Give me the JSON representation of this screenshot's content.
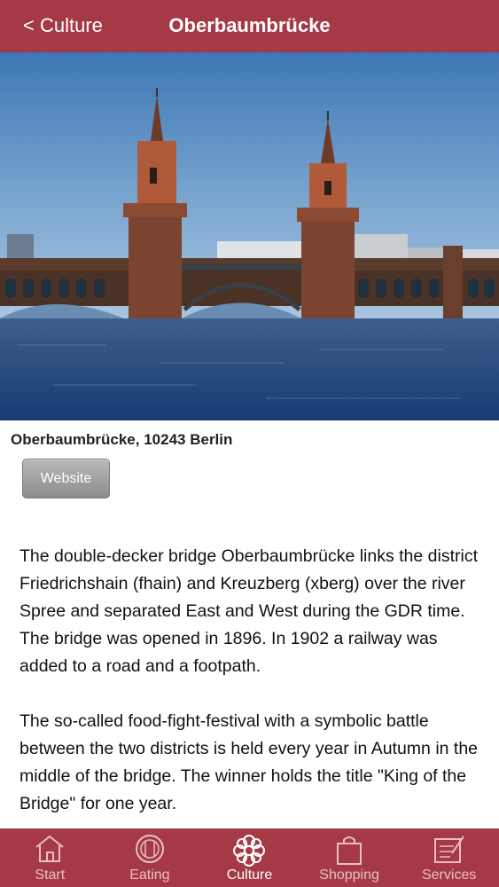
{
  "navbar": {
    "back_label": "< Culture",
    "title": "Oberbaumbrücke"
  },
  "hero": {
    "alt": "Oberbaumbrücke bridge over the river Spree"
  },
  "address": "Oberbaumbrücke, 10243 Berlin",
  "website_button": "Website",
  "paragraphs": [
    "The double-decker bridge Oberbaumbrücke links the district Friedrichshain (fhain) and Kreuzberg (xberg) over the river Spree and separated East and West during the GDR time. The bridge was opened in 1896. In 1902 a railway was added to a road and a footpath.",
    "The so-called food-fight-festival with a symbolic battle between the two districts is held every year in Autumn in the middle of the bridge. The winner holds the title \"King of the Bridge\" for one year."
  ],
  "tabs": [
    {
      "label": "Start",
      "icon": "home-icon",
      "active": false
    },
    {
      "label": "Eating",
      "icon": "plate-icon",
      "active": false
    },
    {
      "label": "Culture",
      "icon": "flower-icon",
      "active": true
    },
    {
      "label": "Shopping",
      "icon": "bag-icon",
      "active": false
    },
    {
      "label": "Services",
      "icon": "notepad-icon",
      "active": false
    }
  ],
  "colors": {
    "brand": "#a53946",
    "tab_inactive": "#e8c0c5",
    "tab_active": "#ffffff"
  }
}
